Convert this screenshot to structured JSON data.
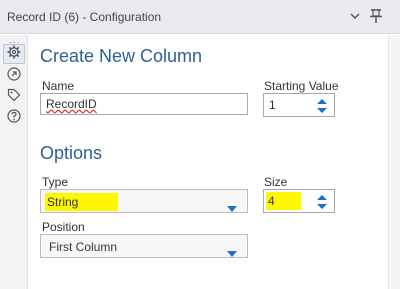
{
  "window": {
    "title": "Record ID (6) - Configuration",
    "collapse_icon": "chevron-down-icon",
    "pin_icon": "pin-icon"
  },
  "sidebar": {
    "overflow_dots": "...",
    "items": [
      {
        "icon": "gear-icon",
        "active": true
      },
      {
        "icon": "navigate-icon",
        "active": false
      },
      {
        "icon": "tag-icon",
        "active": false
      },
      {
        "icon": "help-icon",
        "active": false
      }
    ]
  },
  "create_section": {
    "title": "Create New Column",
    "name_label": "Name",
    "name_value": "RecordID",
    "starting_value_label": "Starting Value",
    "starting_value": "1"
  },
  "options_section": {
    "title": "Options",
    "type_label": "Type",
    "type_value": "String",
    "size_label": "Size",
    "size_value": "4",
    "position_label": "Position",
    "position_value": "First Column"
  },
  "colors": {
    "accent": "#2e5f96",
    "highlight": "#fff700",
    "dropdown_caret": "#1e6fc9"
  }
}
